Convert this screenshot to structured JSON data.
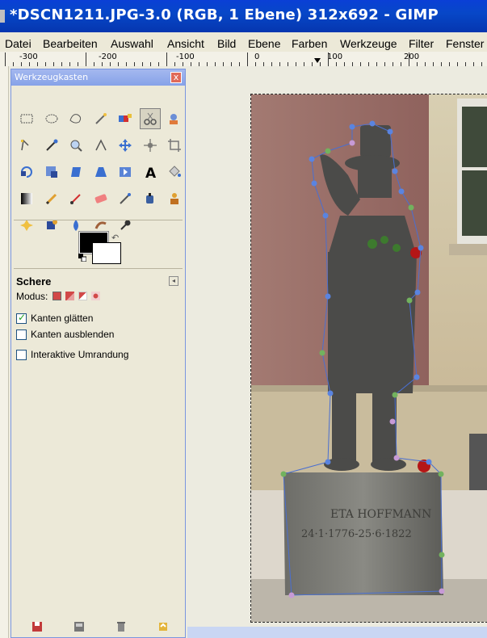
{
  "window": {
    "title": "*DSCN1211.JPG-3.0 (RGB, 1 Ebene) 312x692 - GIMP"
  },
  "menu": {
    "items": [
      "Datei",
      "Bearbeiten",
      "Auswahl",
      "Ansicht",
      "Bild",
      "Ebene",
      "Farben",
      "Werkzeuge",
      "Filter",
      "Fenster"
    ]
  },
  "ruler": {
    "labels": [
      "-300",
      "-200",
      "-100",
      "0",
      "100",
      "200"
    ]
  },
  "toolbox": {
    "title": "Werkzeugkasten",
    "close_label": "x",
    "tools": [
      "rect-select",
      "ellipse-select",
      "free-select",
      "fuzzy-select",
      "select-by-color",
      "scissors-select",
      "foreground-select",
      "paths",
      "color-picker",
      "zoom",
      "measure",
      "move",
      "align",
      "crop",
      "rotate",
      "scale",
      "shear",
      "perspective",
      "flip",
      "text",
      "bucket-fill",
      "blend",
      "pencil",
      "paintbrush",
      "eraser",
      "airbrush",
      "ink",
      "clone",
      "heal",
      "perspective-clone",
      "blur",
      "smudge",
      "dodge-burn"
    ],
    "active_tool": "scissors-select",
    "colors": {
      "foreground": "#000000",
      "background": "#ffffff"
    }
  },
  "tool_options": {
    "title": "Schere",
    "mode_label": "Modus:",
    "options": [
      {
        "label": "Kanten glätten",
        "checked": true
      },
      {
        "label": "Kanten ausblenden",
        "checked": false
      },
      {
        "label": "Interaktive Umrandung",
        "checked": false
      }
    ]
  },
  "photo": {
    "inscription_line1": "ETA HOFFMANN",
    "inscription_line2": "24·1·1776-25·6·1822"
  },
  "colors": {
    "titlebar": "#0747c8",
    "toolbox_title": "#86a2e8",
    "wall": "#9b6f6b",
    "statue": "#4a4a48"
  }
}
